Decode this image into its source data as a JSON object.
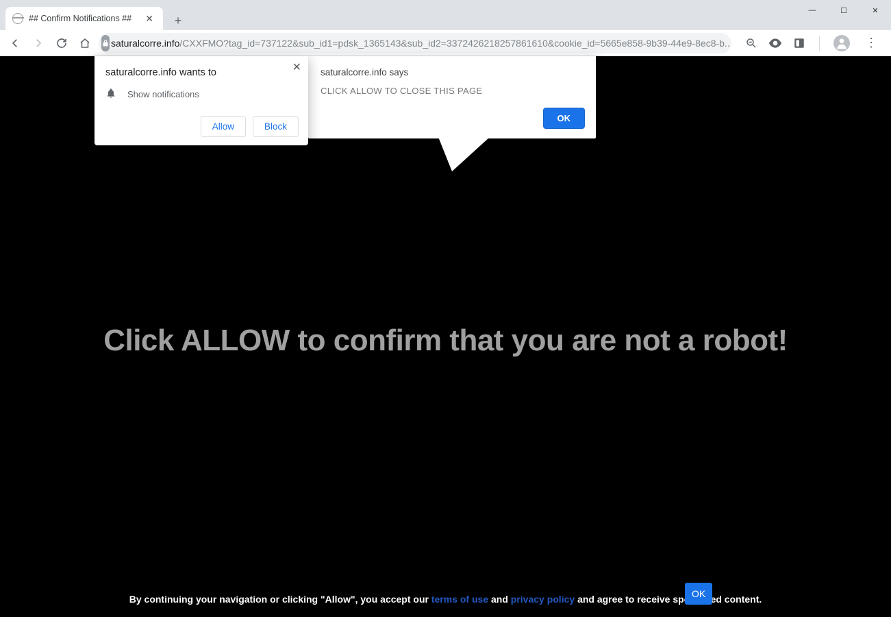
{
  "window": {
    "minimize": "—",
    "maximize": "☐",
    "close": "✕"
  },
  "tab": {
    "title": "## Confirm Notifications ##",
    "close": "✕"
  },
  "newtab": "+",
  "url": {
    "domain": "saturalcorre.info",
    "rest": "/CXXFMO?tag_id=737122&sub_id1=pdsk_1365143&sub_id2=3372426218257861610&cookie_id=5665e858-9b39-44e9-8ec8-b..."
  },
  "permission": {
    "title": "saturalcorre.info wants to",
    "item": "Show notifications",
    "allow": "Allow",
    "block": "Block",
    "close": "✕"
  },
  "jsdialog": {
    "title": "saturalcorre.info says",
    "message": "CLICK ALLOW TO CLOSE THIS PAGE",
    "ok": "OK"
  },
  "page": {
    "headline": "Click ALLOW to confirm that you are not a robot!",
    "footer_prefix": "By continuing your navigation or clicking \"Allow\", you accept our ",
    "terms": "terms of use",
    "and": " and ",
    "privacy": "privacy policy",
    "footer_suffix": " and agree to receive sponsored content.",
    "ok": "OK"
  }
}
